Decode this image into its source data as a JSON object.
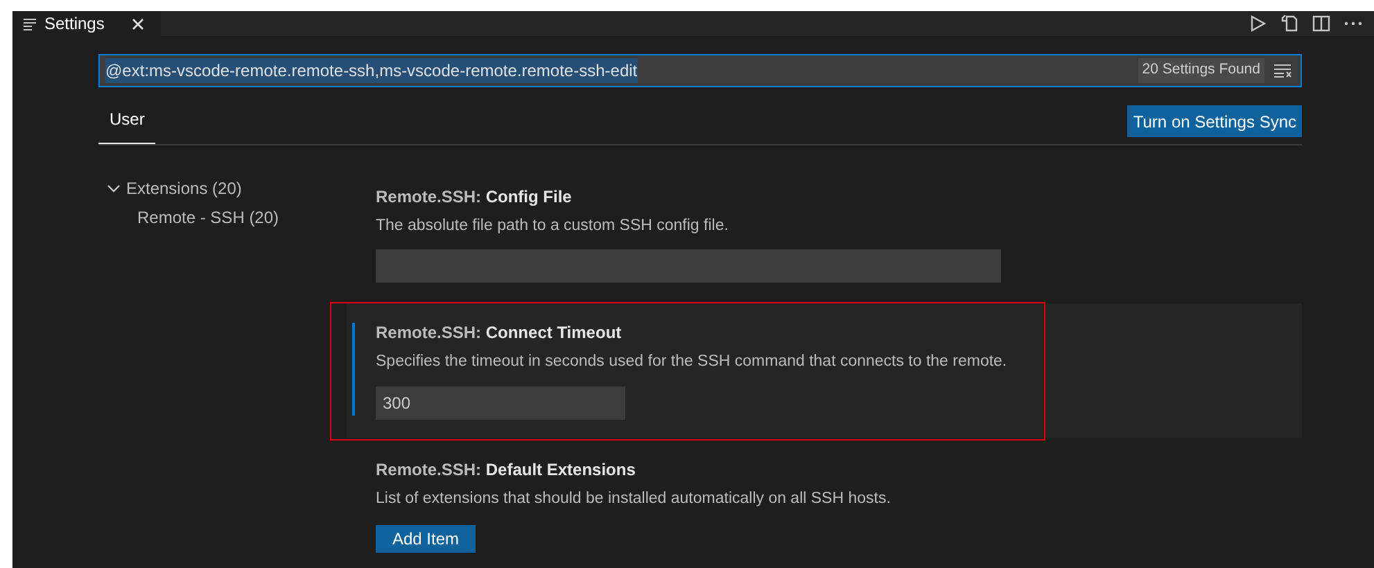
{
  "editor_tabs": [
    {
      "label": "Settings",
      "selected": true
    }
  ],
  "search": {
    "value": "@ext:ms-vscode-remote.remote-ssh,ms-vscode-remote.remote-ssh-edit",
    "result_count": "20 Settings Found"
  },
  "scope_tabs": [
    {
      "label": "User",
      "selected": true
    }
  ],
  "sync_button": "Turn on Settings Sync",
  "toc": [
    {
      "label": "Extensions (20)",
      "expanded": true,
      "children": [
        {
          "label": "Remote - SSH (20)"
        }
      ]
    }
  ],
  "settings": [
    {
      "kind": "text",
      "category": "Remote.SSH: ",
      "name": "Config File",
      "description": "The absolute file path to a custom SSH config file."
    },
    {
      "kind": "number",
      "category": "Remote.SSH: ",
      "name": "Connect Timeout",
      "description": "Specifies the timeout in seconds used for the SSH command that connects to the remote.",
      "value": "300",
      "focused": true
    },
    {
      "kind": "array",
      "category": "Remote.SSH: ",
      "name": "Default Extensions",
      "description": "List of extensions that should be installed automatically on all SSH hosts.",
      "button": "Add Item"
    }
  ]
}
